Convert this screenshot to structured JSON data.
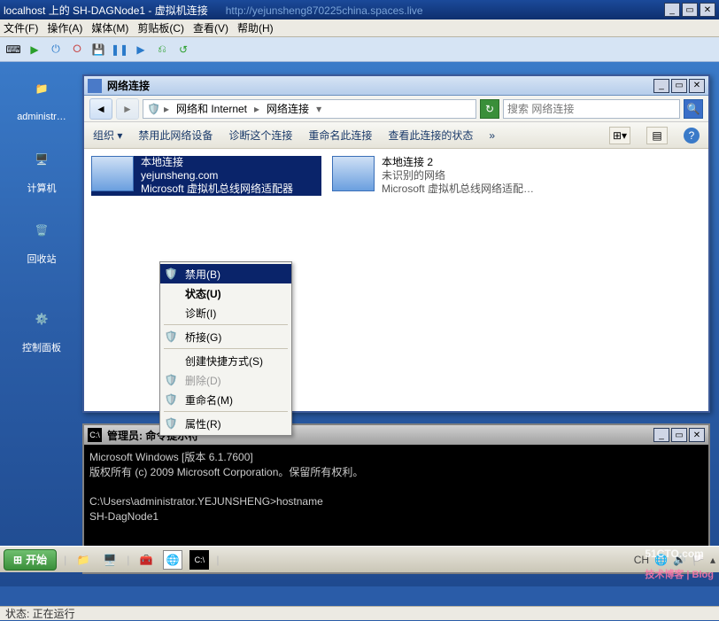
{
  "outer": {
    "title": "localhost 上的 SH-DAGNode1 - 虚拟机连接",
    "url_hint": "http://yejunsheng870225china.spaces.live"
  },
  "menubar": {
    "file": "文件(F)",
    "action": "操作(A)",
    "media": "媒体(M)",
    "clipboard": "剪贴板(C)",
    "view": "查看(V)",
    "help": "帮助(H)"
  },
  "desktop_icons": {
    "admin": "administr…",
    "computer": "计算机",
    "recycle": "回收站",
    "controlpanel": "控制面板"
  },
  "netwin": {
    "title": "网络连接",
    "breadcrumb": {
      "root": "网络和 Internet",
      "leaf": "网络连接"
    },
    "search_placeholder": "搜索 网络连接",
    "cmdbar": {
      "organize": "组织 ▾",
      "disable": "禁用此网络设备",
      "diagnose": "诊断这个连接",
      "rename": "重命名此连接",
      "viewstatus": "查看此连接的状态",
      "more": "»"
    },
    "conn1": {
      "name": "本地连接",
      "domain": "yejunsheng.com",
      "adapter": "Microsoft 虚拟机总线网络适配器"
    },
    "conn2": {
      "name": "本地连接 2",
      "status": "未识别的网络",
      "adapter": "Microsoft 虚拟机总线网络适配…"
    }
  },
  "ctx": {
    "disable": "禁用(B)",
    "status": "状态(U)",
    "diagnose": "诊断(I)",
    "bridge": "桥接(G)",
    "shortcut": "创建快捷方式(S)",
    "delete": "删除(D)",
    "rename": "重命名(M)",
    "properties": "属性(R)"
  },
  "cmd": {
    "title": "管理员: 命令提示符",
    "line1": "Microsoft Windows [版本 6.1.7600]",
    "line2": "版权所有 (c) 2009 Microsoft Corporation。保留所有权利。",
    "line3": "C:\\Users\\administrator.YEJUNSHENG>hostname",
    "line4": "SH-DagNode1"
  },
  "taskbar": {
    "start": "开始",
    "ime": "CH"
  },
  "statusbar": {
    "text": "状态: 正在运行"
  },
  "watermark": {
    "main": "51CTO.com",
    "sub": "技术博客 | Blog"
  }
}
